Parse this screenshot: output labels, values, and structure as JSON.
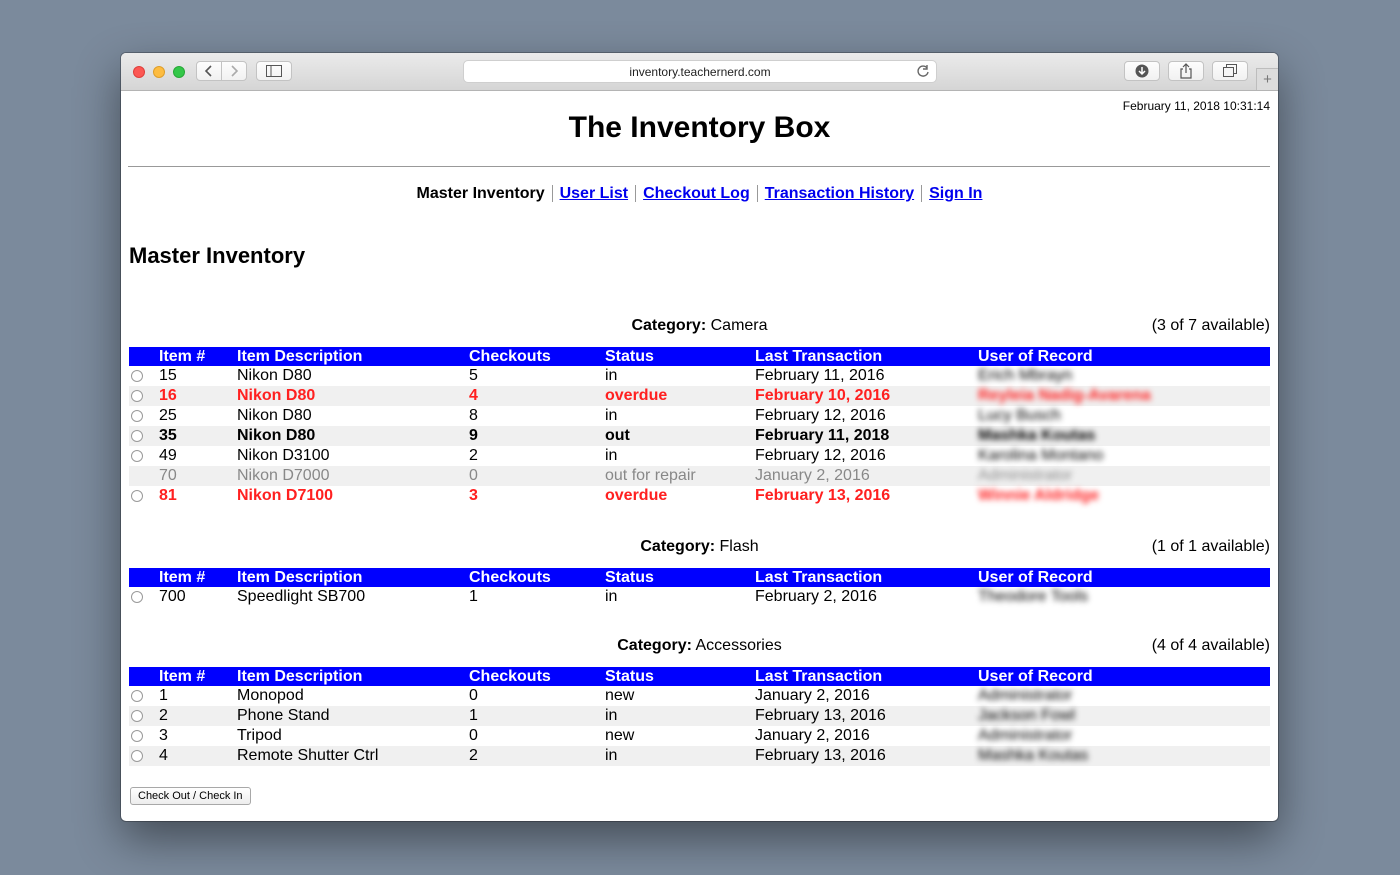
{
  "browser": {
    "url": "inventory.teachernerd.com"
  },
  "page": {
    "datetime": "February 11, 2018 10:31:14",
    "site_title": "The Inventory Box",
    "nav": {
      "current": "Master Inventory",
      "links": [
        "User List",
        "Checkout Log",
        "Transaction History",
        "Sign In"
      ]
    },
    "section_title": "Master Inventory",
    "category_label": "Category:",
    "columns": [
      "Item #",
      "Item Description",
      "Checkouts",
      "Status",
      "Last Transaction",
      "User of Record"
    ],
    "categories": [
      {
        "name": "Camera",
        "availability": "(3 of 7 available)",
        "rows": [
          {
            "item": "15",
            "desc": "Nikon D80",
            "checkouts": "5",
            "status": "in",
            "last": "February 11, 2016",
            "user": "Erich Mbrayn",
            "style": "normal"
          },
          {
            "item": "16",
            "desc": "Nikon D80",
            "checkouts": "4",
            "status": "overdue",
            "last": "February 10, 2016",
            "user": "Reyleia Nadig-Avarena",
            "style": "overdue"
          },
          {
            "item": "25",
            "desc": "Nikon D80",
            "checkouts": "8",
            "status": "in",
            "last": "February 12, 2016",
            "user": "Lucy Busch",
            "style": "normal"
          },
          {
            "item": "35",
            "desc": "Nikon D80",
            "checkouts": "9",
            "status": "out",
            "last": "February 11, 2018",
            "user": "Mashka Koutas",
            "style": "out"
          },
          {
            "item": "49",
            "desc": "Nikon D3100",
            "checkouts": "2",
            "status": "in",
            "last": "February 12, 2016",
            "user": "Karolina Montano",
            "style": "normal"
          },
          {
            "item": "70",
            "desc": "Nikon D7000",
            "checkouts": "0",
            "status": "out for repair",
            "last": "January 2, 2016",
            "user": "Administrator",
            "style": "repair"
          },
          {
            "item": "81",
            "desc": "Nikon D7100",
            "checkouts": "3",
            "status": "overdue",
            "last": "February 13, 2016",
            "user": "Winnie Aldridge",
            "style": "overdue"
          }
        ]
      },
      {
        "name": "Flash",
        "availability": "(1 of 1 available)",
        "rows": [
          {
            "item": "700",
            "desc": "Speedlight SB700",
            "checkouts": "1",
            "status": "in",
            "last": "February 2, 2016",
            "user": "Theodore Tools",
            "style": "normal"
          }
        ]
      },
      {
        "name": "Accessories",
        "availability": "(4 of 4 available)",
        "rows": [
          {
            "item": "1",
            "desc": "Monopod",
            "checkouts": "0",
            "status": "new",
            "last": "January 2, 2016",
            "user": "Administrator",
            "style": "normal"
          },
          {
            "item": "2",
            "desc": "Phone Stand",
            "checkouts": "1",
            "status": "in",
            "last": "February 13, 2016",
            "user": "Jackson Fowl",
            "style": "normal"
          },
          {
            "item": "3",
            "desc": "Tripod",
            "checkouts": "0",
            "status": "new",
            "last": "January 2, 2016",
            "user": "Administrator",
            "style": "normal"
          },
          {
            "item": "4",
            "desc": "Remote Shutter Ctrl",
            "checkouts": "2",
            "status": "in",
            "last": "February 13, 2016",
            "user": "Mashka Koutas",
            "style": "normal"
          }
        ]
      }
    ],
    "checkout_button": "Check Out / Check In"
  },
  "colors": {
    "header_bg": "#0000ff",
    "overdue": "#ff2020",
    "link": "#0000ee",
    "stripe": "#f0f0f0"
  }
}
